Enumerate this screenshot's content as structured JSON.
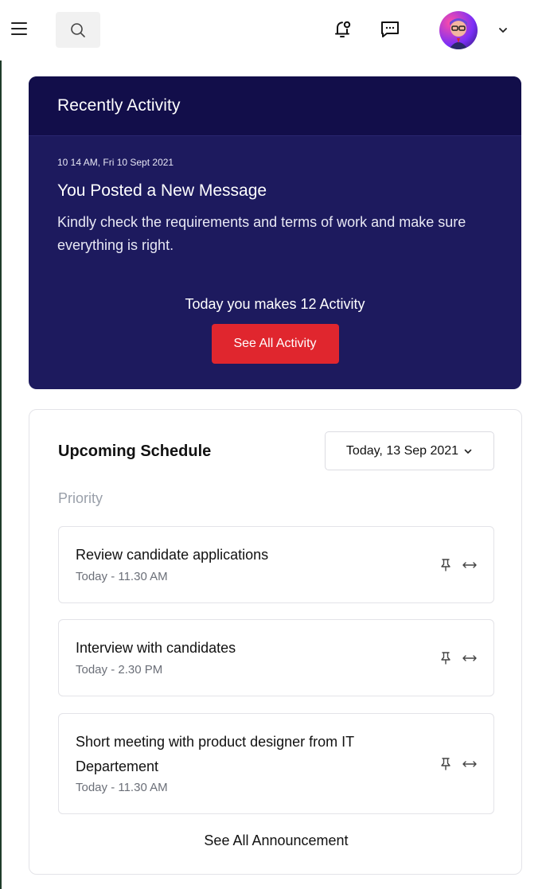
{
  "topbar": {
    "icons": [
      "menu-icon",
      "search-icon",
      "bell-icon",
      "chat-icon",
      "avatar",
      "chevron-down-icon"
    ]
  },
  "activity": {
    "heading": "Recently Activity",
    "timestamp": "10 14 AM, Fri 10 Sept 2021",
    "post_title": "You Posted a New Message",
    "post_desc": "Kindly check the requirements and terms of work and make sure everything is right.",
    "today_count": "Today you makes 12 Activity",
    "see_all_label": "See All Activity",
    "colors": {
      "card_bg": "#1d1a5e",
      "header_bg": "#120e4a",
      "button_bg": "#e0262e"
    }
  },
  "schedule": {
    "title": "Upcoming Schedule",
    "date_select": "Today, 13 Sep 2021",
    "priority_label": "Priority",
    "tasks": [
      {
        "title": "Review candidate applications",
        "time": "Today - 11.30 AM"
      },
      {
        "title": "Interview with candidates",
        "time": "Today - 2.30 PM"
      },
      {
        "title": "Short meeting with product designer from IT Departement",
        "time": "Today - 11.30 AM"
      }
    ],
    "see_all_label": "See All Announcement"
  }
}
